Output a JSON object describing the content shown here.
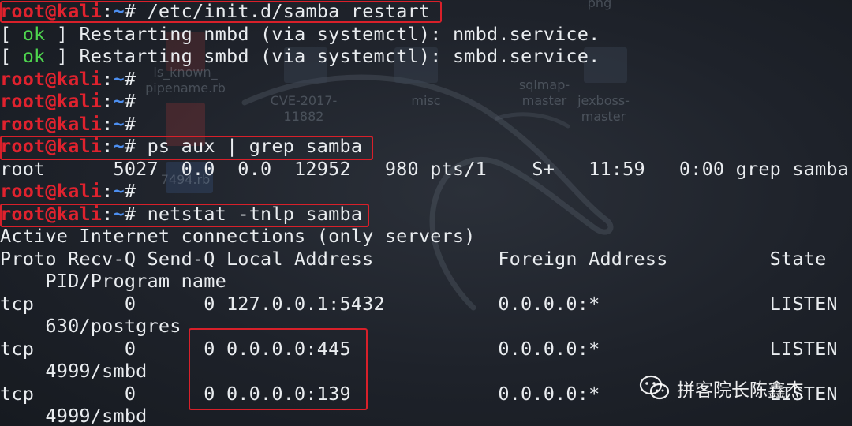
{
  "terminal": {
    "prompt_user": "root@kali",
    "prompt_sep": ":",
    "prompt_path": "~",
    "prompt_char": "#",
    "lines": [
      {
        "kind": "cmd",
        "cmd": "/etc/init.d/samba restart"
      },
      {
        "kind": "ok",
        "pre": "[ ",
        "status": "ok",
        "post": " ] Restarting nmbd (via systemctl): nmbd.service."
      },
      {
        "kind": "ok",
        "pre": "[ ",
        "status": "ok",
        "post": " ] Restarting smbd (via systemctl): smbd.service."
      },
      {
        "kind": "cmd",
        "cmd": ""
      },
      {
        "kind": "cmd",
        "cmd": ""
      },
      {
        "kind": "cmd",
        "cmd": ""
      },
      {
        "kind": "cmd",
        "cmd": "ps aux | grep samba"
      },
      {
        "kind": "text",
        "text": "root      5027  0.0  0.0  12952   980 pts/1    S+   11:59   0:00 grep samba"
      },
      {
        "kind": "cmd",
        "cmd": ""
      },
      {
        "kind": "cmd",
        "cmd": "netstat -tnlp samba"
      },
      {
        "kind": "text",
        "text": "Active Internet connections (only servers)"
      },
      {
        "kind": "text",
        "text": "Proto Recv-Q Send-Q Local Address           Foreign Address         State"
      },
      {
        "kind": "text",
        "text": "    PID/Program name"
      },
      {
        "kind": "text",
        "text": "tcp        0      0 127.0.0.1:5432          0.0.0.0:*               LISTEN"
      },
      {
        "kind": "text",
        "text": "    630/postgres"
      },
      {
        "kind": "text",
        "text": "tcp        0      0 0.0.0.0:445             0.0.0.0:*               LISTEN"
      },
      {
        "kind": "text",
        "text": "    4999/smbd"
      },
      {
        "kind": "text",
        "text": "tcp        0      0 0.0.0.0:139             0.0.0.0:*               LISTEN"
      },
      {
        "kind": "text",
        "text": "    4999/smbd"
      }
    ]
  },
  "desktop_icons": [
    {
      "label": "png"
    },
    {
      "label": "is_known_ pipename.rb"
    },
    {
      "label": "CVE-2017- 11882"
    },
    {
      "label": "misc"
    },
    {
      "label": "sqlmap- master"
    },
    {
      "label": "jexboss- master"
    },
    {
      "label": "7494.rb"
    }
  ],
  "watermark": {
    "text": "拼客院长陈鑫杰",
    "icon": "wechat-icon"
  },
  "colors": {
    "prompt_user": "#e0222e",
    "prompt_path": "#4d8ff0",
    "ok": "#4ed44e",
    "highlight": "#d8202a",
    "text": "#e9ecef"
  }
}
